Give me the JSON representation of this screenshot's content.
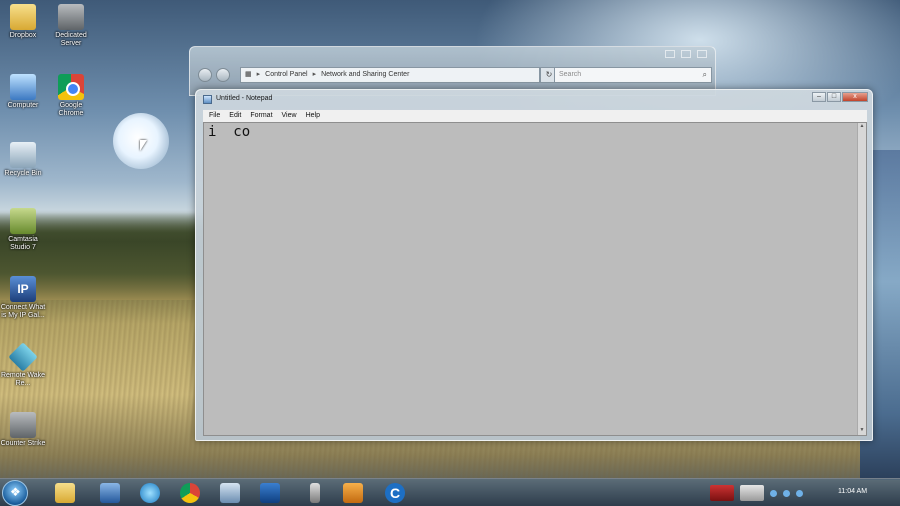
{
  "desktop": {
    "icons": [
      {
        "label": "Dropbox"
      },
      {
        "label": "Dedicated Server"
      },
      {
        "label": "Computer"
      },
      {
        "label": "Google Chrome"
      },
      {
        "label": "Recycle Bin"
      },
      {
        "label": "Camtasia Studio 7"
      },
      {
        "label": "Connect What is My IP Gal..."
      },
      {
        "label": "Remote Wake Re..."
      },
      {
        "label": "Counter Strike"
      }
    ]
  },
  "explorer": {
    "breadcrumb": [
      "Control Panel",
      "Network and Sharing Center"
    ],
    "search_placeholder": "Search"
  },
  "notepad": {
    "title": "Untitled - Notepad",
    "menu": [
      "File",
      "Edit",
      "Format",
      "View",
      "Help"
    ],
    "content": "i  co",
    "close_glyph": "x",
    "min_glyph": "–",
    "max_glyph": "□"
  },
  "taskbar": {
    "clock": "11:04 AM",
    "c_icon_letter": "C"
  },
  "colors": {
    "taskbar": "#3c5060",
    "editor_bg": "#bcbcbc",
    "close_button": "#c2432a"
  }
}
